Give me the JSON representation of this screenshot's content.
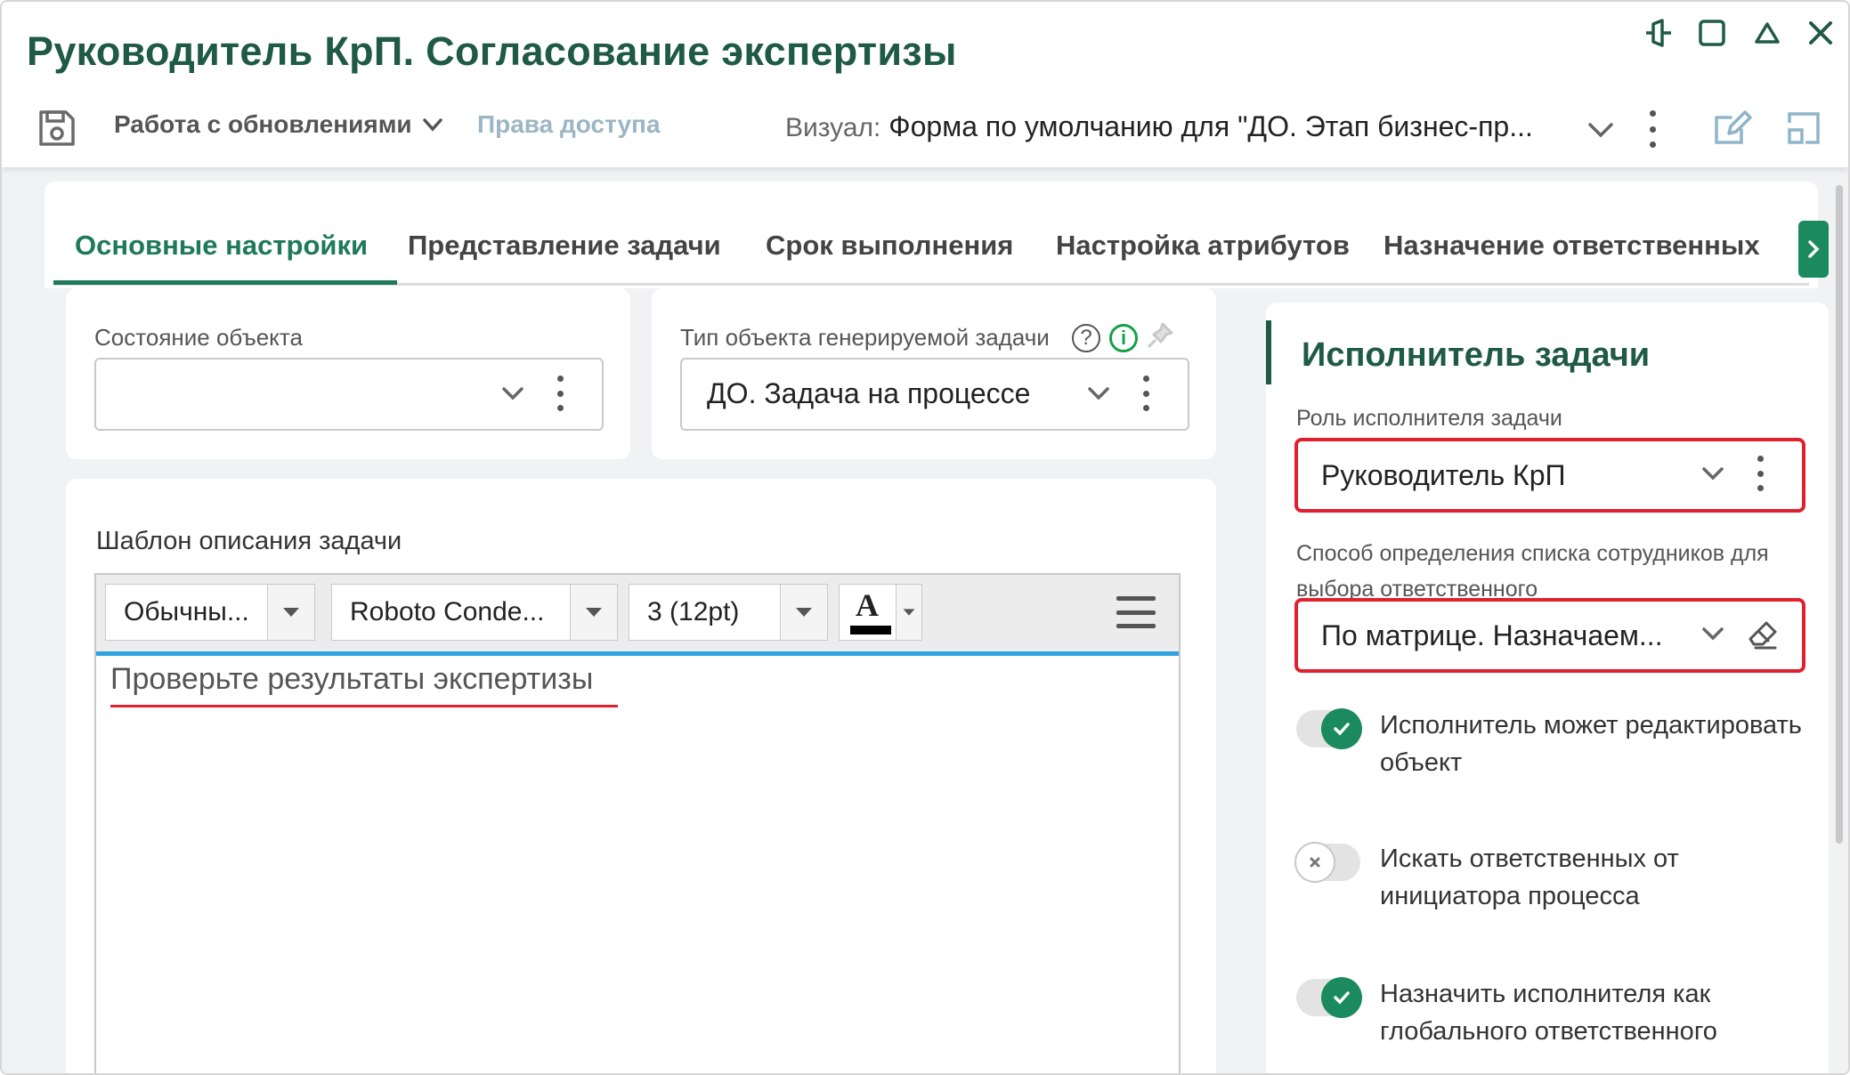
{
  "window": {
    "title": "Руководитель КрП. Согласование экспертизы"
  },
  "toolbar": {
    "updates_menu_label": "Работа с обновлениями",
    "access_rights_label": "Права доступа",
    "visual_label": "Визуал:",
    "visual_value": "Форма по умолчанию для \"ДО. Этап бизнес-пр..."
  },
  "tabs": [
    {
      "label": "Основные настройки",
      "active": true
    },
    {
      "label": "Представление задачи",
      "active": false
    },
    {
      "label": "Срок выполнения",
      "active": false
    },
    {
      "label": "Настройка атрибутов",
      "active": false
    },
    {
      "label": "Назначение ответственных",
      "active": false
    }
  ],
  "object_state": {
    "label": "Состояние объекта",
    "value": ""
  },
  "task_object_type": {
    "label": "Тип объекта генерируемой задачи",
    "help_glyph": "?",
    "info_glyph": "i",
    "value": "ДО. Задача на процессе"
  },
  "description_template": {
    "label": "Шаблон описания задачи",
    "style_value": "Обычны...",
    "font_value": "Roboto Conde...",
    "size_value": "3 (12pt)",
    "text_color_glyph": "A",
    "text": "Проверьте результаты экспертизы"
  },
  "executor": {
    "section_title": "Исполнитель задачи",
    "role_label": "Роль исполнителя задачи",
    "role_value": "Руководитель КрП",
    "method_label": "Способ определения списка сотрудников для выбора ответственного",
    "method_value": "По матрице. Назначаем...",
    "toggles": [
      {
        "label": "Исполнитель может редактировать объект",
        "on": true
      },
      {
        "label": "Искать ответственных от инициатора процесса",
        "on": false
      },
      {
        "label": "Назначить исполнителя как глобального ответственного",
        "on": true
      }
    ]
  },
  "colors": {
    "brand_green": "#1e5a44",
    "accent_green": "#1b8a5e",
    "highlight_red": "#e0202e",
    "editor_blue": "#2fa3dd"
  },
  "icons": {
    "window_controls": [
      "pin-icon",
      "maximize-icon",
      "collapse-icon",
      "close-icon"
    ],
    "toolbar": [
      "save-icon",
      "chevron-down-icon",
      "kebab-icon",
      "edit-icon",
      "layout-icon"
    ]
  }
}
